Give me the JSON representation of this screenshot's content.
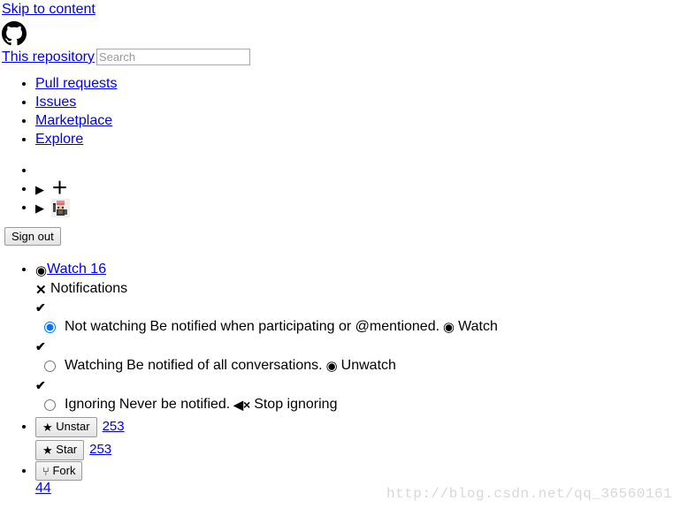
{
  "header": {
    "skip_link": "Skip to content",
    "logo_icon": "github-octocat-icon",
    "scope_link": "This repository",
    "search_placeholder": "Search",
    "search_value": ""
  },
  "nav": {
    "items": [
      {
        "label": "Pull requests"
      },
      {
        "label": "Issues"
      },
      {
        "label": "Marketplace"
      },
      {
        "label": "Explore"
      }
    ]
  },
  "userbar": {
    "items": [
      {
        "icon": "",
        "label": ""
      },
      {
        "icon": "triangle-right-icon",
        "glyph": "▶",
        "action_icon": "plus-icon",
        "action_glyph": "＋"
      },
      {
        "icon": "triangle-right-icon",
        "glyph": "▶",
        "action_icon": "avatar-image"
      }
    ],
    "sign_out_label": "Sign out"
  },
  "repo_actions": {
    "watch": {
      "icon": "eye-icon",
      "icon_glyph": "◉",
      "label": "Watch 16",
      "count": "16"
    },
    "notifications": {
      "icon": "x-icon",
      "icon_glyph": "✕",
      "label": "Notifications"
    },
    "check_glyph": "✔",
    "options": [
      {
        "id": "not-watching",
        "selected": true,
        "title": "Not watching",
        "description": "Be notified when participating or @mentioned.",
        "action_icon": "eye-icon",
        "action_icon_glyph": "◉",
        "action_label": "Watch"
      },
      {
        "id": "watching",
        "selected": false,
        "title": "Watching",
        "description": "Be notified of all conversations.",
        "action_icon": "eye-icon",
        "action_icon_glyph": "◉",
        "action_label": "Unwatch"
      },
      {
        "id": "ignoring",
        "selected": false,
        "title": "Ignoring",
        "description": "Never be notified.",
        "action_icon": "mute-icon",
        "action_icon_glyph": "🔇",
        "action_label": "Stop ignoring"
      }
    ],
    "star": {
      "unstar_icon": "star-filled-icon",
      "unstar_glyph": "★",
      "unstar_label": "Unstar",
      "unstar_count": "253",
      "star_icon": "star-filled-icon",
      "star_glyph": "★",
      "star_label": "Star",
      "star_count": "253"
    },
    "fork": {
      "icon": "fork-icon",
      "glyph": "⑂",
      "label": "Fork",
      "count": "44"
    }
  },
  "watermark": {
    "text": "http://blog.csdn.net/qq_36560161"
  },
  "colors": {
    "link": "#0000EE",
    "text": "#000000",
    "placeholder": "#999999",
    "watermark": "#D8D8D8"
  }
}
